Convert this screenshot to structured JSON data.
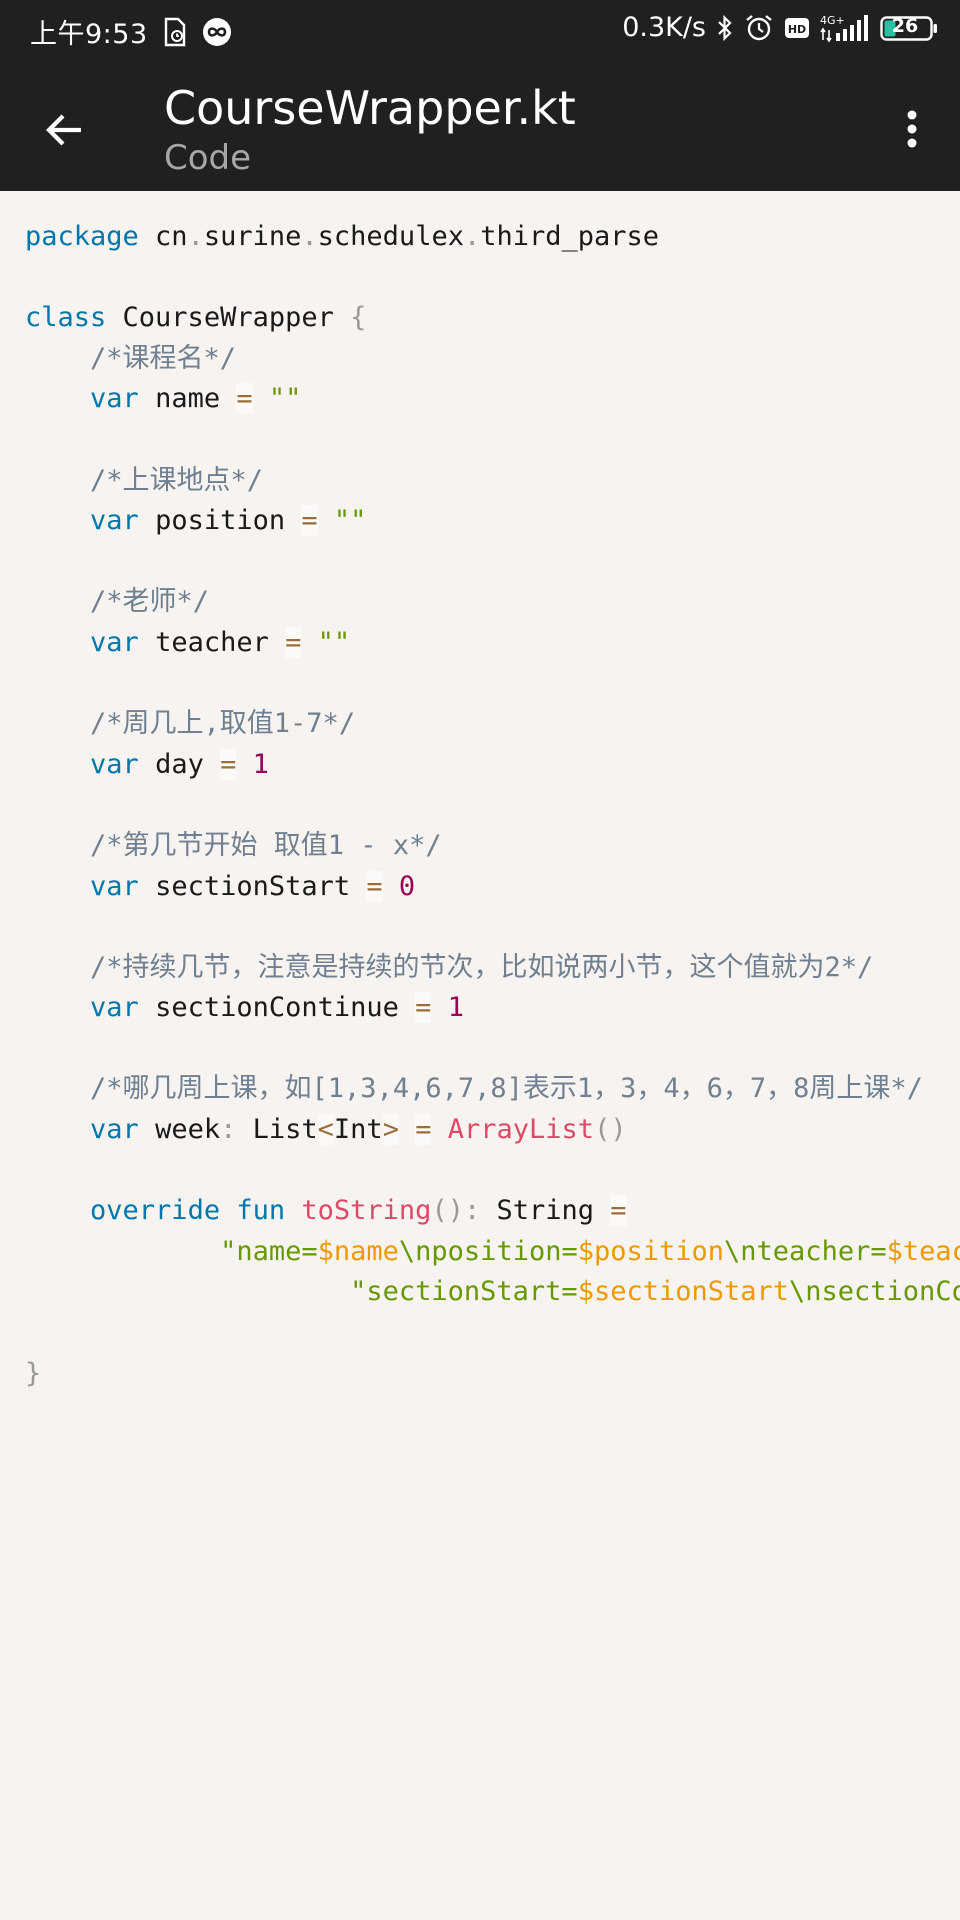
{
  "status_bar": {
    "time": "上午9:53",
    "speed": "0.3K/s",
    "network_label": "4G+",
    "hd_label": "HD",
    "battery": "26",
    "icons": [
      "file-icon",
      "infinity-app-icon",
      "bluetooth-icon",
      "alarm-icon",
      "hd-icon",
      "signal-icon",
      "battery-icon"
    ]
  },
  "app_bar": {
    "title": "CourseWrapper.kt",
    "subtitle": "Code",
    "back_icon": "arrow-back-icon",
    "more_icon": "more-vert-icon"
  },
  "code": {
    "language": "kotlin",
    "lines": [
      [
        {
          "t": "kw",
          "v": "package"
        },
        {
          "t": "plain",
          "v": " cn"
        },
        {
          "t": "punc",
          "v": "."
        },
        {
          "t": "plain",
          "v": "surine"
        },
        {
          "t": "punc",
          "v": "."
        },
        {
          "t": "plain",
          "v": "schedulex"
        },
        {
          "t": "punc",
          "v": "."
        },
        {
          "t": "plain",
          "v": "third_parse"
        }
      ],
      [],
      [
        {
          "t": "kw",
          "v": "class"
        },
        {
          "t": "plain",
          "v": " CourseWrapper "
        },
        {
          "t": "punc",
          "v": "{"
        }
      ],
      [
        {
          "t": "plain",
          "v": "    "
        },
        {
          "t": "cmt",
          "v": "/*课程名*/"
        }
      ],
      [
        {
          "t": "plain",
          "v": "    "
        },
        {
          "t": "kw",
          "v": "var"
        },
        {
          "t": "plain",
          "v": " name "
        },
        {
          "t": "op",
          "v": "="
        },
        {
          "t": "plain",
          "v": " "
        },
        {
          "t": "str",
          "v": "\"\""
        }
      ],
      [],
      [
        {
          "t": "plain",
          "v": "    "
        },
        {
          "t": "cmt",
          "v": "/*上课地点*/"
        }
      ],
      [
        {
          "t": "plain",
          "v": "    "
        },
        {
          "t": "kw",
          "v": "var"
        },
        {
          "t": "plain",
          "v": " position "
        },
        {
          "t": "op",
          "v": "="
        },
        {
          "t": "plain",
          "v": " "
        },
        {
          "t": "str",
          "v": "\"\""
        }
      ],
      [],
      [
        {
          "t": "plain",
          "v": "    "
        },
        {
          "t": "cmt",
          "v": "/*老师*/"
        }
      ],
      [
        {
          "t": "plain",
          "v": "    "
        },
        {
          "t": "kw",
          "v": "var"
        },
        {
          "t": "plain",
          "v": " teacher "
        },
        {
          "t": "op",
          "v": "="
        },
        {
          "t": "plain",
          "v": " "
        },
        {
          "t": "str",
          "v": "\"\""
        }
      ],
      [],
      [
        {
          "t": "plain",
          "v": "    "
        },
        {
          "t": "cmt",
          "v": "/*周几上,取值1-7*/"
        }
      ],
      [
        {
          "t": "plain",
          "v": "    "
        },
        {
          "t": "kw",
          "v": "var"
        },
        {
          "t": "plain",
          "v": " day "
        },
        {
          "t": "op",
          "v": "="
        },
        {
          "t": "plain",
          "v": " "
        },
        {
          "t": "num",
          "v": "1"
        }
      ],
      [],
      [
        {
          "t": "plain",
          "v": "    "
        },
        {
          "t": "cmt",
          "v": "/*第几节开始 取值1 - x*/"
        }
      ],
      [
        {
          "t": "plain",
          "v": "    "
        },
        {
          "t": "kw",
          "v": "var"
        },
        {
          "t": "plain",
          "v": " sectionStart "
        },
        {
          "t": "op",
          "v": "="
        },
        {
          "t": "plain",
          "v": " "
        },
        {
          "t": "num",
          "v": "0"
        }
      ],
      [],
      [
        {
          "t": "plain",
          "v": "    "
        },
        {
          "t": "cmt",
          "v": "/*持续几节，注意是持续的节次，比如说两小节，这个值就为2*/"
        }
      ],
      [
        {
          "t": "plain",
          "v": "    "
        },
        {
          "t": "kw",
          "v": "var"
        },
        {
          "t": "plain",
          "v": " sectionContinue "
        },
        {
          "t": "op",
          "v": "="
        },
        {
          "t": "plain",
          "v": " "
        },
        {
          "t": "num",
          "v": "1"
        }
      ],
      [],
      [
        {
          "t": "plain",
          "v": "    "
        },
        {
          "t": "cmt",
          "v": "/*哪几周上课，如[1,3,4,6,7,8]表示1，3，4，6，7，8周上课*/"
        }
      ],
      [
        {
          "t": "plain",
          "v": "    "
        },
        {
          "t": "kw",
          "v": "var"
        },
        {
          "t": "plain",
          "v": " week"
        },
        {
          "t": "punc",
          "v": ":"
        },
        {
          "t": "plain",
          "v": " List"
        },
        {
          "t": "op",
          "v": "<"
        },
        {
          "t": "plain",
          "v": "Int"
        },
        {
          "t": "op",
          "v": ">"
        },
        {
          "t": "plain",
          "v": " "
        },
        {
          "t": "op",
          "v": "="
        },
        {
          "t": "plain",
          "v": " "
        },
        {
          "t": "fn",
          "v": "ArrayList"
        },
        {
          "t": "punc",
          "v": "()"
        }
      ],
      [],
      [
        {
          "t": "plain",
          "v": "    "
        },
        {
          "t": "kw",
          "v": "override"
        },
        {
          "t": "plain",
          "v": " "
        },
        {
          "t": "kw",
          "v": "fun"
        },
        {
          "t": "plain",
          "v": " "
        },
        {
          "t": "fn",
          "v": "toString"
        },
        {
          "t": "punc",
          "v": "():"
        },
        {
          "t": "plain",
          "v": " String "
        },
        {
          "t": "op",
          "v": "="
        }
      ],
      [
        {
          "t": "plain",
          "v": "            "
        },
        {
          "t": "str",
          "v": "\"name="
        },
        {
          "t": "var",
          "v": "$name"
        },
        {
          "t": "str",
          "v": "\\nposition="
        },
        {
          "t": "var",
          "v": "$position"
        },
        {
          "t": "str",
          "v": "\\nteacher="
        },
        {
          "t": "var",
          "v": "$teacher"
        }
      ],
      [
        {
          "t": "plain",
          "v": "                    "
        },
        {
          "t": "str",
          "v": "\"sectionStart="
        },
        {
          "t": "var",
          "v": "$sectionStart"
        },
        {
          "t": "str",
          "v": "\\nsectionContinue"
        }
      ],
      [],
      [
        {
          "t": "punc",
          "v": "}"
        }
      ]
    ]
  },
  "colors": {
    "status_bar_bg": "#202020",
    "app_bar_bg": "#202020",
    "content_bg": "#f6f3f0",
    "keyword": "#0077aa",
    "comment": "#708090",
    "string": "#669900",
    "number": "#990055",
    "function": "#dd4a68",
    "template_var": "#ee9900",
    "punctuation": "#999999",
    "operator": "#9a6e3a"
  }
}
